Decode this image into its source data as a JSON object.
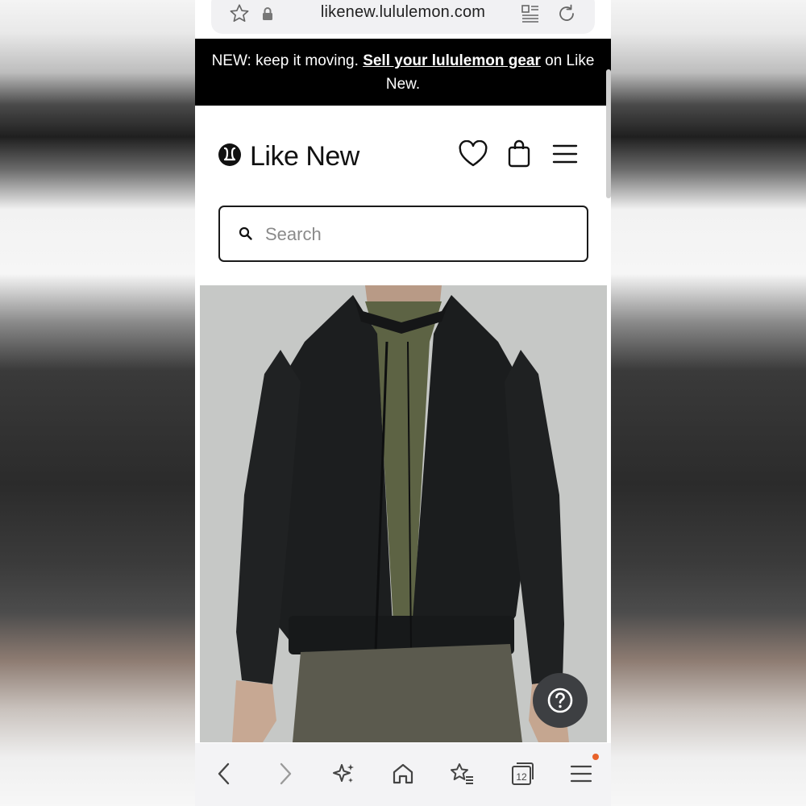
{
  "browser": {
    "url": "likenew.lululemon.com",
    "tab_count": "12"
  },
  "banner": {
    "prefix": "NEW: keep it moving. ",
    "link": "Sell your lululemon gear",
    "suffix": " on Like New."
  },
  "header": {
    "brand": "Like New"
  },
  "search": {
    "placeholder": "Search"
  },
  "colors": {
    "banner_bg": "#000000",
    "notification_dot": "#e8622a",
    "help_button": "#3d3f42"
  }
}
